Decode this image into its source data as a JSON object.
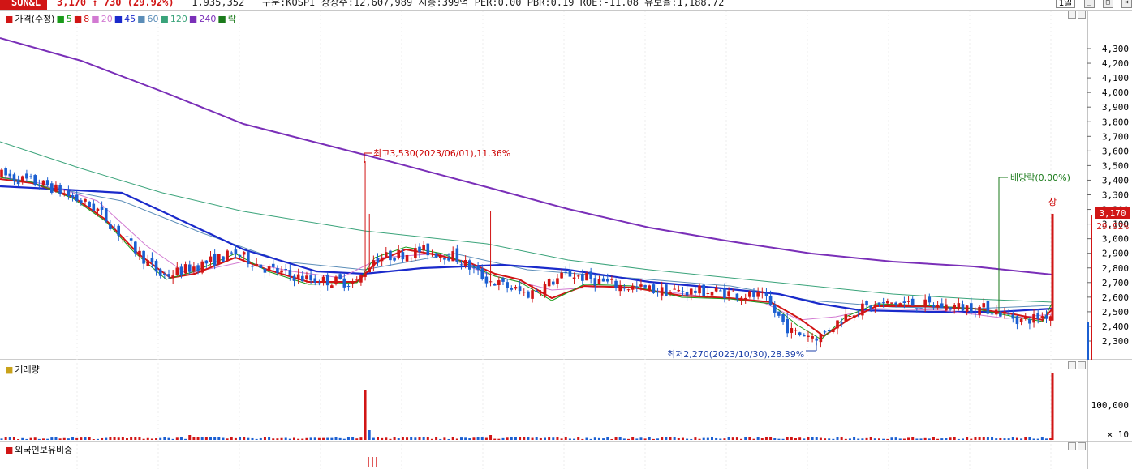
{
  "header": {
    "ticker": "SUN&L",
    "price": "3,170",
    "arrow": "↑",
    "change": "730",
    "change_pct": "(29.92%)",
    "volume": "1,935,352",
    "stats": "구분:KOSPI 상장수:12,607,989 시총:399억 PER:0.00 PBR:0.19 ROE:-11.08 유보율:1,188.72",
    "period": "1일"
  },
  "price_panel": {
    "legend": [
      {
        "label": "가격(수정)",
        "color": "#d11515"
      },
      {
        "label": "5",
        "color": "#1a9b1a"
      },
      {
        "label": "8",
        "color": "#d11515"
      },
      {
        "label": "20",
        "color": "#d27ad2"
      },
      {
        "label": "45",
        "color": "#1a2acb"
      },
      {
        "label": "60",
        "color": "#5b8db8"
      },
      {
        "label": "120",
        "color": "#3aa37a"
      },
      {
        "label": "240",
        "color": "#7a2fb8"
      },
      {
        "label": "락",
        "color": "#1a7a1a"
      }
    ],
    "y_ticks": [
      "4,300",
      "4,200",
      "4,100",
      "4,000",
      "3,900",
      "3,800",
      "3,700",
      "3,600",
      "3,500",
      "3,400",
      "3,300",
      "3,200",
      "3,100",
      "3,000",
      "2,900",
      "2,800",
      "2,700",
      "2,600",
      "2,500",
      "2,400",
      "2,300"
    ],
    "high_annotation": "최고3,530(2023/06/01),11.36%",
    "low_annotation": "최저2,270(2023/10/30),28.39%",
    "dividend_annotation": "배당락(0.00%)",
    "limit_up_label": "상",
    "current_price_label": "3,170",
    "current_pct_label": "29.92%"
  },
  "volume_panel": {
    "legend": "거래량",
    "y_ticks": [
      "100,000"
    ],
    "unit": "× 10"
  },
  "foreign_panel": {
    "legend": "외국인보유비중"
  },
  "chart_data": {
    "type": "candlestick",
    "ylim": [
      2200,
      4400
    ],
    "high": {
      "date": "2023/06/01",
      "value": 3530
    },
    "low": {
      "date": "2023/10/30",
      "value": 2270
    },
    "last": {
      "value": 3170,
      "change": 730,
      "change_pct": 29.92
    },
    "ma_colors": {
      "ma5": "#1a9b1a",
      "ma8": "#d11515",
      "ma20": "#d27ad2",
      "ma45": "#1a2acb",
      "ma60": "#5b8db8",
      "ma120": "#3aa37a",
      "ma240": "#7a2fb8"
    },
    "up_color": "#d11515",
    "down_color": "#1b5fd1"
  }
}
